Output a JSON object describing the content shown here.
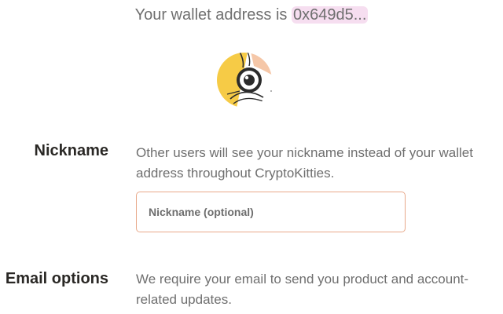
{
  "wallet": {
    "prefix": "Your wallet address is ",
    "address": "0x649d5..."
  },
  "avatar": {
    "icon": "cryptokitty-avatar-icon",
    "colors": {
      "background": "#f6cb46",
      "accent": "#f5c7a8"
    }
  },
  "nickname": {
    "label": "Nickname",
    "description": "Other users will see your nickname instead of your wallet address throughout CryptoKitties.",
    "input_value": "",
    "input_placeholder": "Nickname (optional)"
  },
  "email": {
    "label": "Email options",
    "description": "We require your email to send you product and account-related updates."
  },
  "colors": {
    "address_highlight": "#f6def0",
    "input_border": "#e8a98a",
    "body_text": "#6f6f6f",
    "heading_text": "#2a2825"
  }
}
